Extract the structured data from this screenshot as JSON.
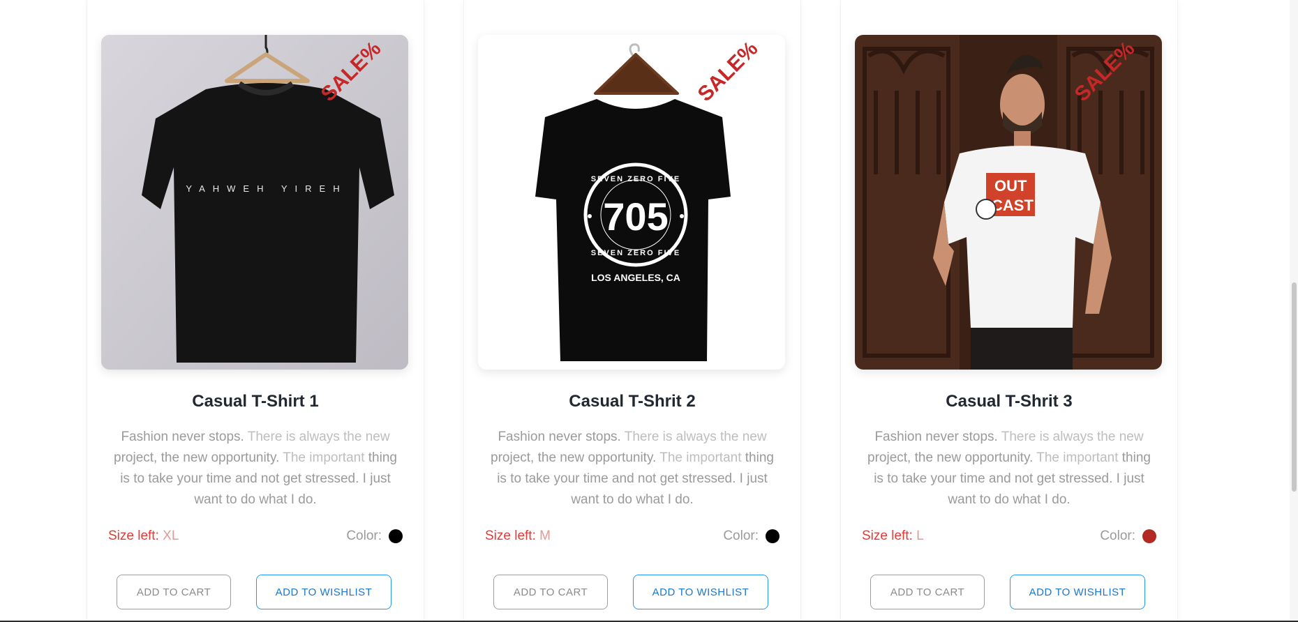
{
  "products": [
    {
      "title": "Casual T-Shirt 1",
      "badge": "SALE%",
      "desc_parts": [
        "Fashion never stops.",
        " There is always the new",
        " project, the new opportunity.",
        " The important",
        " thing is to take your time and not get stressed.",
        " I just want to do what I do."
      ],
      "size_label": "Size left:",
      "size_value": "XL",
      "color_label": "Color:",
      "color_hex": "#000000",
      "add_to_cart": "ADD TO CART",
      "add_to_wishlist": "ADD TO WISHLIST",
      "shirt_text": "YAHWEH YIREH"
    },
    {
      "title": "Casual T-Shrit 2",
      "badge": "SALE%",
      "desc_parts": [
        "Fashion never stops.",
        " There is always the new",
        " project, the new opportunity.",
        " The important",
        " thing is to take your time and not get stressed.",
        " I just want to do what I do."
      ],
      "size_label": "Size left:",
      "size_value": "M",
      "color_label": "Color:",
      "color_hex": "#000000",
      "add_to_cart": "ADD TO CART",
      "add_to_wishlist": "ADD TO WISHLIST",
      "print_top": "SEVEN ZERO FIVE",
      "print_number": "705",
      "print_bottom": "SEVEN ZERO FIVE",
      "print_location": "LOS ANGELES, CA"
    },
    {
      "title": "Casual T-Shrit 3",
      "badge": "SALE%",
      "desc_parts": [
        "Fashion never stops.",
        " There is always the new",
        " project, the new opportunity.",
        " The important",
        " thing is to take your time and not get stressed.",
        " I just want to do what I do."
      ],
      "size_label": "Size left:",
      "size_value": "L",
      "color_label": "Color:",
      "color_hex": "#b22a22",
      "add_to_cart": "ADD TO CART",
      "add_to_wishlist": "ADD TO WISHLIST",
      "print_line1": "OUT",
      "print_line2": "CAST"
    }
  ]
}
